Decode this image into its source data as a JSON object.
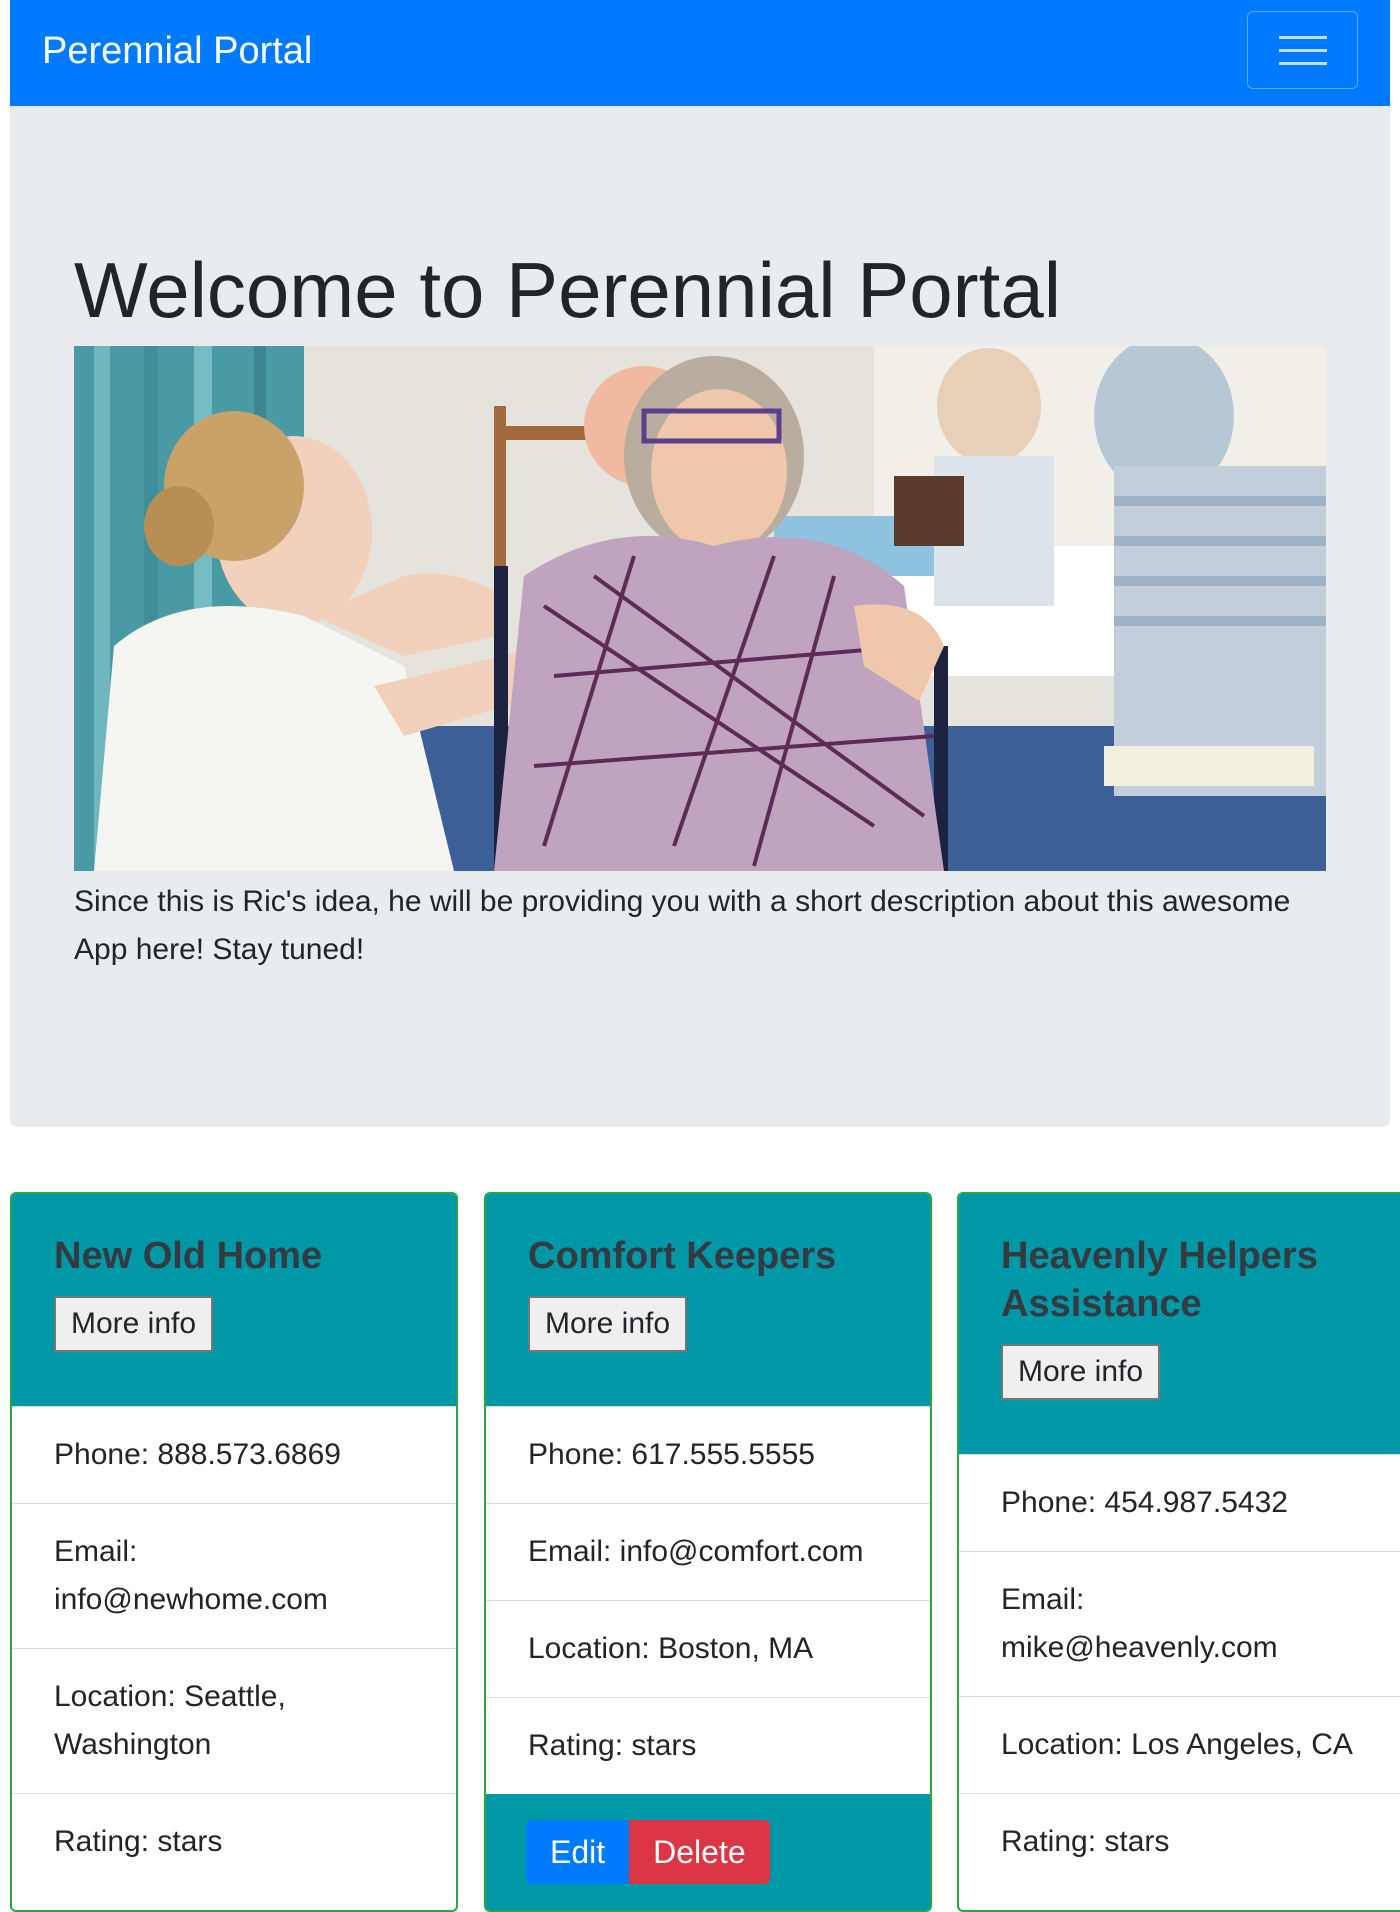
{
  "navbar": {
    "brand": "Perennial Portal"
  },
  "jumbotron": {
    "title": "Welcome to Perennial Portal",
    "description": "Since this is Ric's idea, he will be providing you with a short description about this awesome App here! Stay tuned!"
  },
  "cards": [
    {
      "name": "New Old Home",
      "more_info_label": "More info",
      "phone": "Phone: 888.573.6869",
      "email": "Email: info@newhome.com",
      "location": "Location: Seattle, Washington",
      "rating": "Rating: stars"
    },
    {
      "name": "Comfort Keepers",
      "more_info_label": "More info",
      "phone": "Phone: 617.555.5555",
      "email": "Email: info@comfort.com",
      "location": "Location: Boston, MA",
      "rating": "Rating: stars",
      "edit_label": "Edit",
      "delete_label": "Delete"
    },
    {
      "name": "Heavenly Helpers Assistance",
      "more_info_label": "More info",
      "phone": "Phone: 454.987.5432",
      "email": "Email: mike@heavenly.com",
      "location": "Location: Los Angeles, CA",
      "rating": "Rating: stars"
    }
  ],
  "colors": {
    "navbar": "#007bff",
    "jumbotron": "#e9ecef",
    "card_header": "#0097a7",
    "card_border": "#28a745",
    "edit_button": "#007bff",
    "delete_button": "#dc3545"
  }
}
